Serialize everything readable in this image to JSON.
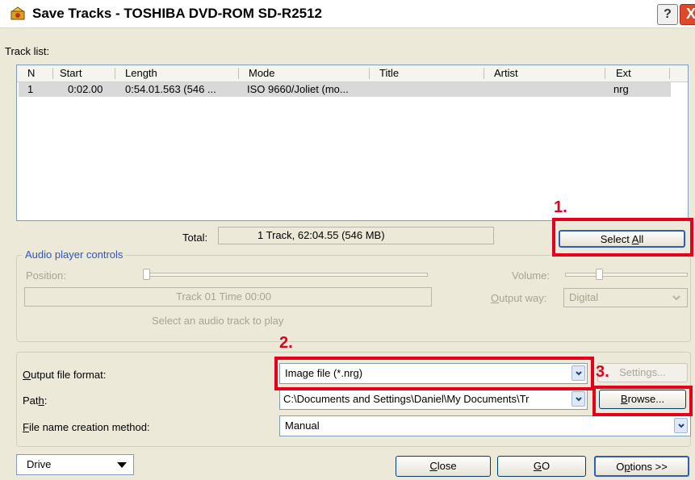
{
  "window": {
    "title": "Save Tracks - TOSHIBA  DVD-ROM SD-R2512",
    "help_label": "?",
    "close_label": "X"
  },
  "tracklist": {
    "label": "Track list:",
    "columns": [
      "N",
      "Start",
      "Length",
      "Mode",
      "Title",
      "Artist",
      "Ext"
    ],
    "rows": [
      {
        "n": "1",
        "start": "0:02.00",
        "length": "0:54.01.563 (546 ...",
        "mode": "ISO 9660/Joliet (mo...",
        "title": "",
        "artist": "",
        "ext": "nrg"
      }
    ]
  },
  "total": {
    "label": "Total:",
    "value": "1 Track,  62:04.55 (546 MB)"
  },
  "select_all": {
    "prefix": "Select ",
    "key": "A",
    "suffix": "ll"
  },
  "audio": {
    "group_label": "Audio player controls",
    "position_label": "Position:",
    "volume_label": "Volume:",
    "track_time": "Track 01 Time 00:00",
    "output_prefix": "",
    "output_key": "O",
    "output_suffix": "utput way:",
    "output_value": "Digital",
    "hint": "Select an audio track to play"
  },
  "output_format": {
    "key": "O",
    "label_rest": "utput file format:",
    "value": "Image file (*.nrg)",
    "settings_label": "Settings..."
  },
  "path": {
    "label_prefix": "Pat",
    "key": "h",
    "label_suffix": ":",
    "value": "C:\\Documents and Settings\\Daniel\\My Documents\\Tr",
    "browse_key": "B",
    "browse_rest": "rowse..."
  },
  "naming": {
    "key": "F",
    "label_rest": "ile name creation method:",
    "value": "Manual"
  },
  "footer": {
    "drive_label": "Drive",
    "close_key": "C",
    "close_rest": "lose",
    "go_key": "G",
    "go_rest": "O",
    "options_key": "p",
    "options_prefix": "O",
    "options_rest": "tions >>"
  },
  "annotations": [
    "1.",
    "2.",
    "3."
  ],
  "colors": {
    "highlight": "#e4001b",
    "dialog_bg": "#ece9d8",
    "accent_blue": "#003c74"
  }
}
